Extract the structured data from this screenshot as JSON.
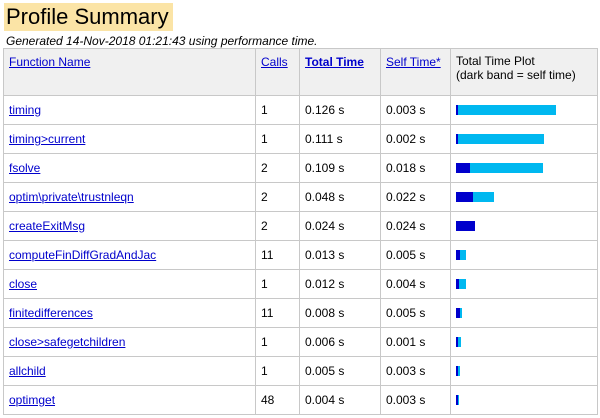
{
  "title": "Profile Summary",
  "generated": "Generated 14-Nov-2018 01:21:43 using performance time.",
  "headers": {
    "function_name": "Function Name",
    "calls": "Calls",
    "total_time": "Total Time",
    "self_time": "Self Time*",
    "plot_line1": "Total Time Plot",
    "plot_line2": "(dark band = self time)"
  },
  "colors": {
    "total_band": "#00b8f0",
    "self_band": "#0000cc",
    "title_bg": "#fbe4a6",
    "link": "#0000cc"
  },
  "rows": [
    {
      "name": "timing",
      "calls": "1",
      "total": "0.126 s",
      "self": "0.003 s",
      "total_v": 0.126,
      "self_v": 0.003
    },
    {
      "name": "timing>current",
      "calls": "1",
      "total": "0.111 s",
      "self": "0.002 s",
      "total_v": 0.111,
      "self_v": 0.002
    },
    {
      "name": "fsolve",
      "calls": "2",
      "total": "0.109 s",
      "self": "0.018 s",
      "total_v": 0.109,
      "self_v": 0.018
    },
    {
      "name": "optim\\private\\trustnleqn",
      "calls": "2",
      "total": "0.048 s",
      "self": "0.022 s",
      "total_v": 0.048,
      "self_v": 0.022
    },
    {
      "name": "createExitMsg",
      "calls": "2",
      "total": "0.024 s",
      "self": "0.024 s",
      "total_v": 0.024,
      "self_v": 0.024
    },
    {
      "name": "computeFinDiffGradAndJac",
      "calls": "11",
      "total": "0.013 s",
      "self": "0.005 s",
      "total_v": 0.013,
      "self_v": 0.005
    },
    {
      "name": "close",
      "calls": "1",
      "total": "0.012 s",
      "self": "0.004 s",
      "total_v": 0.012,
      "self_v": 0.004
    },
    {
      "name": "finitedifferences",
      "calls": "11",
      "total": "0.008 s",
      "self": "0.005 s",
      "total_v": 0.008,
      "self_v": 0.005
    },
    {
      "name": "close>safegetchildren",
      "calls": "1",
      "total": "0.006 s",
      "self": "0.001 s",
      "total_v": 0.006,
      "self_v": 0.001
    },
    {
      "name": "allchild",
      "calls": "1",
      "total": "0.005 s",
      "self": "0.003 s",
      "total_v": 0.005,
      "self_v": 0.003
    },
    {
      "name": "optimget",
      "calls": "48",
      "total": "0.004 s",
      "self": "0.003 s",
      "total_v": 0.004,
      "self_v": 0.003
    }
  ]
}
